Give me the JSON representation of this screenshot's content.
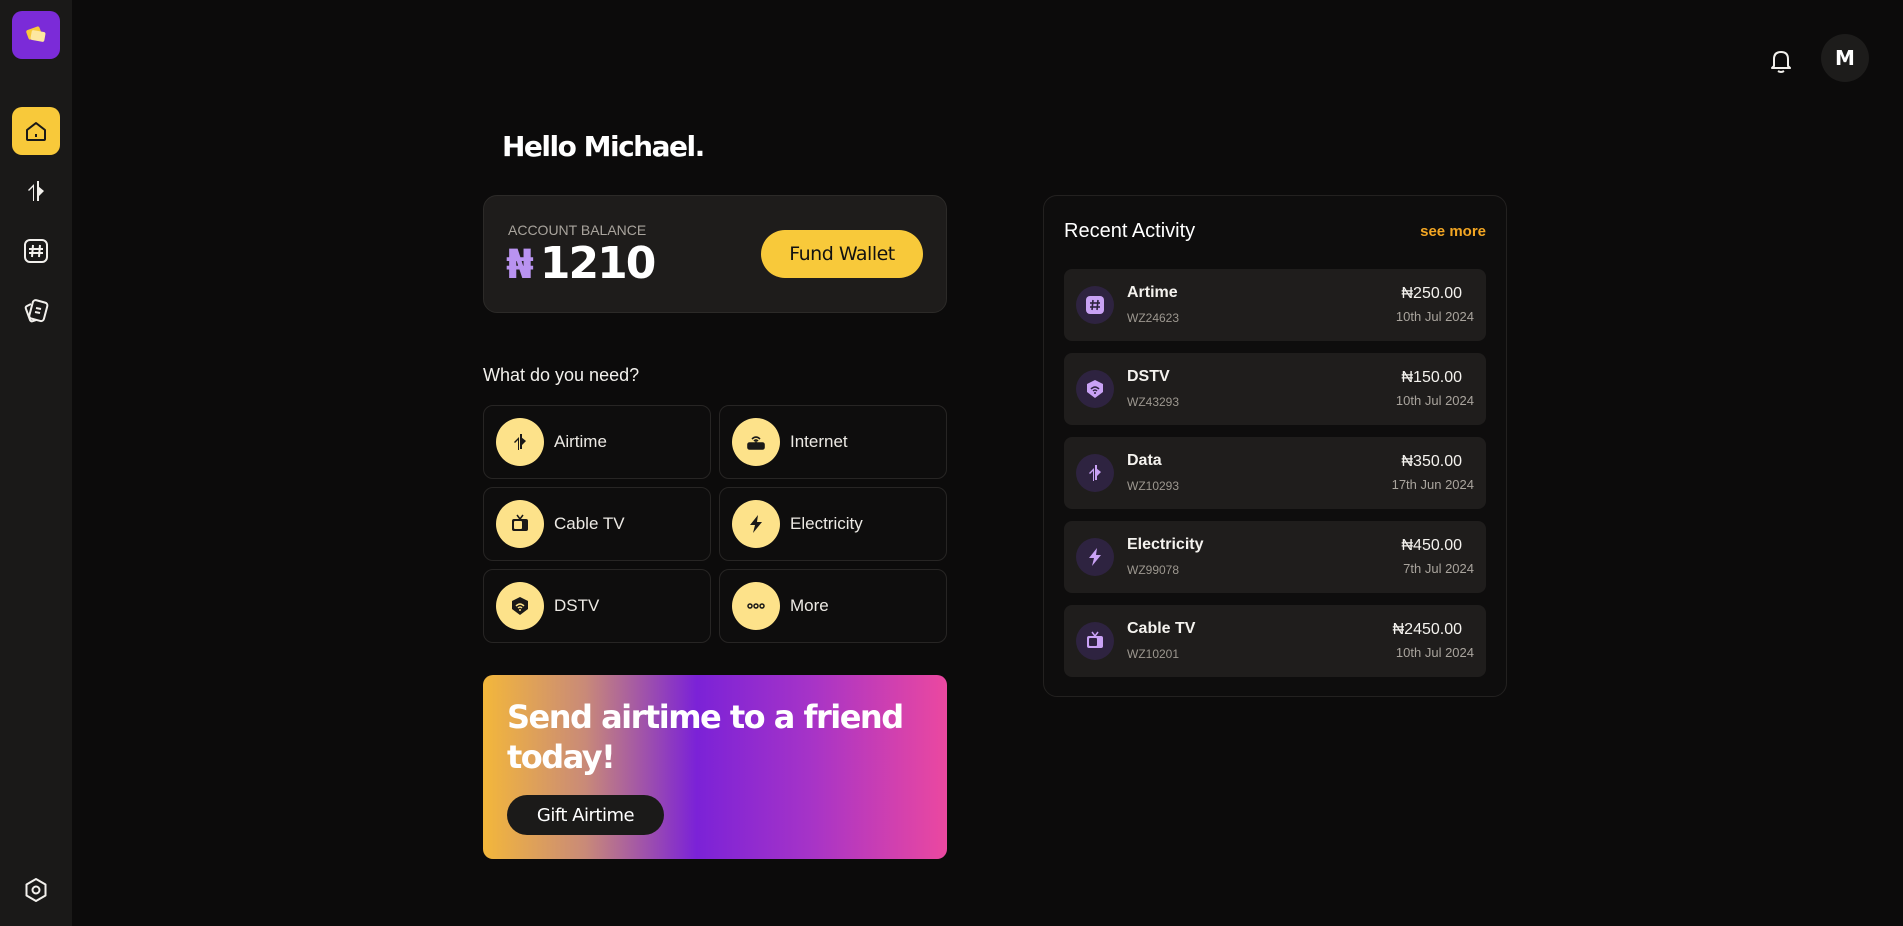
{
  "header": {
    "greeting": "Hello Michael.",
    "avatar_initial": "M"
  },
  "sidebar": {
    "logo_icon": "tickets-icon",
    "items": [
      {
        "name": "home",
        "icon": "home-icon",
        "active": true
      },
      {
        "name": "transfers",
        "icon": "transfer-arrows-icon",
        "active": false
      },
      {
        "name": "airtime",
        "icon": "hash-icon",
        "active": false
      },
      {
        "name": "cards",
        "icon": "cards-icon",
        "active": false
      }
    ],
    "settings_icon": "settings-icon"
  },
  "balance": {
    "label": "ACCOUNT BALANCE",
    "currency": "₦",
    "amount": "1210",
    "fund_label": "Fund Wallet"
  },
  "services": {
    "title": "What do you need?",
    "items": [
      {
        "label": "Airtime",
        "icon": "airtime-icon"
      },
      {
        "label": "Internet",
        "icon": "router-icon"
      },
      {
        "label": "Cable TV",
        "icon": "tv-icon"
      },
      {
        "label": "Electricity",
        "icon": "lightning-icon"
      },
      {
        "label": "DSTV",
        "icon": "dstv-icon"
      },
      {
        "label": "More",
        "icon": "more-dots-icon"
      }
    ]
  },
  "promo": {
    "text": "Send airtime to a friend today!",
    "button_label": "Gift Airtime"
  },
  "activity": {
    "title": "Recent Activity",
    "see_more": "see more",
    "rows": [
      {
        "name": "Artime",
        "ref": "WZ24623",
        "amount": "₦250.00",
        "date": "10th Jul 2024",
        "icon": "hash-icon"
      },
      {
        "name": "DSTV",
        "ref": "WZ43293",
        "amount": "₦150.00",
        "date": "10th Jul 2024",
        "icon": "dstv-icon"
      },
      {
        "name": "Data",
        "ref": "WZ10293",
        "amount": "₦350.00",
        "date": "17th Jun 2024",
        "icon": "transfer-arrows-icon"
      },
      {
        "name": "Electricity",
        "ref": "WZ99078",
        "amount": "₦450.00",
        "date": "7th Jul 2024",
        "icon": "lightning-icon"
      },
      {
        "name": "Cable TV",
        "ref": "WZ10201",
        "amount": "₦2450.00",
        "date": "10th Jul 2024",
        "icon": "tv-icon"
      }
    ]
  },
  "colors": {
    "accent_yellow": "#f8c93a",
    "accent_purple": "#7b2bd8",
    "link_orange": "#f3a623"
  }
}
